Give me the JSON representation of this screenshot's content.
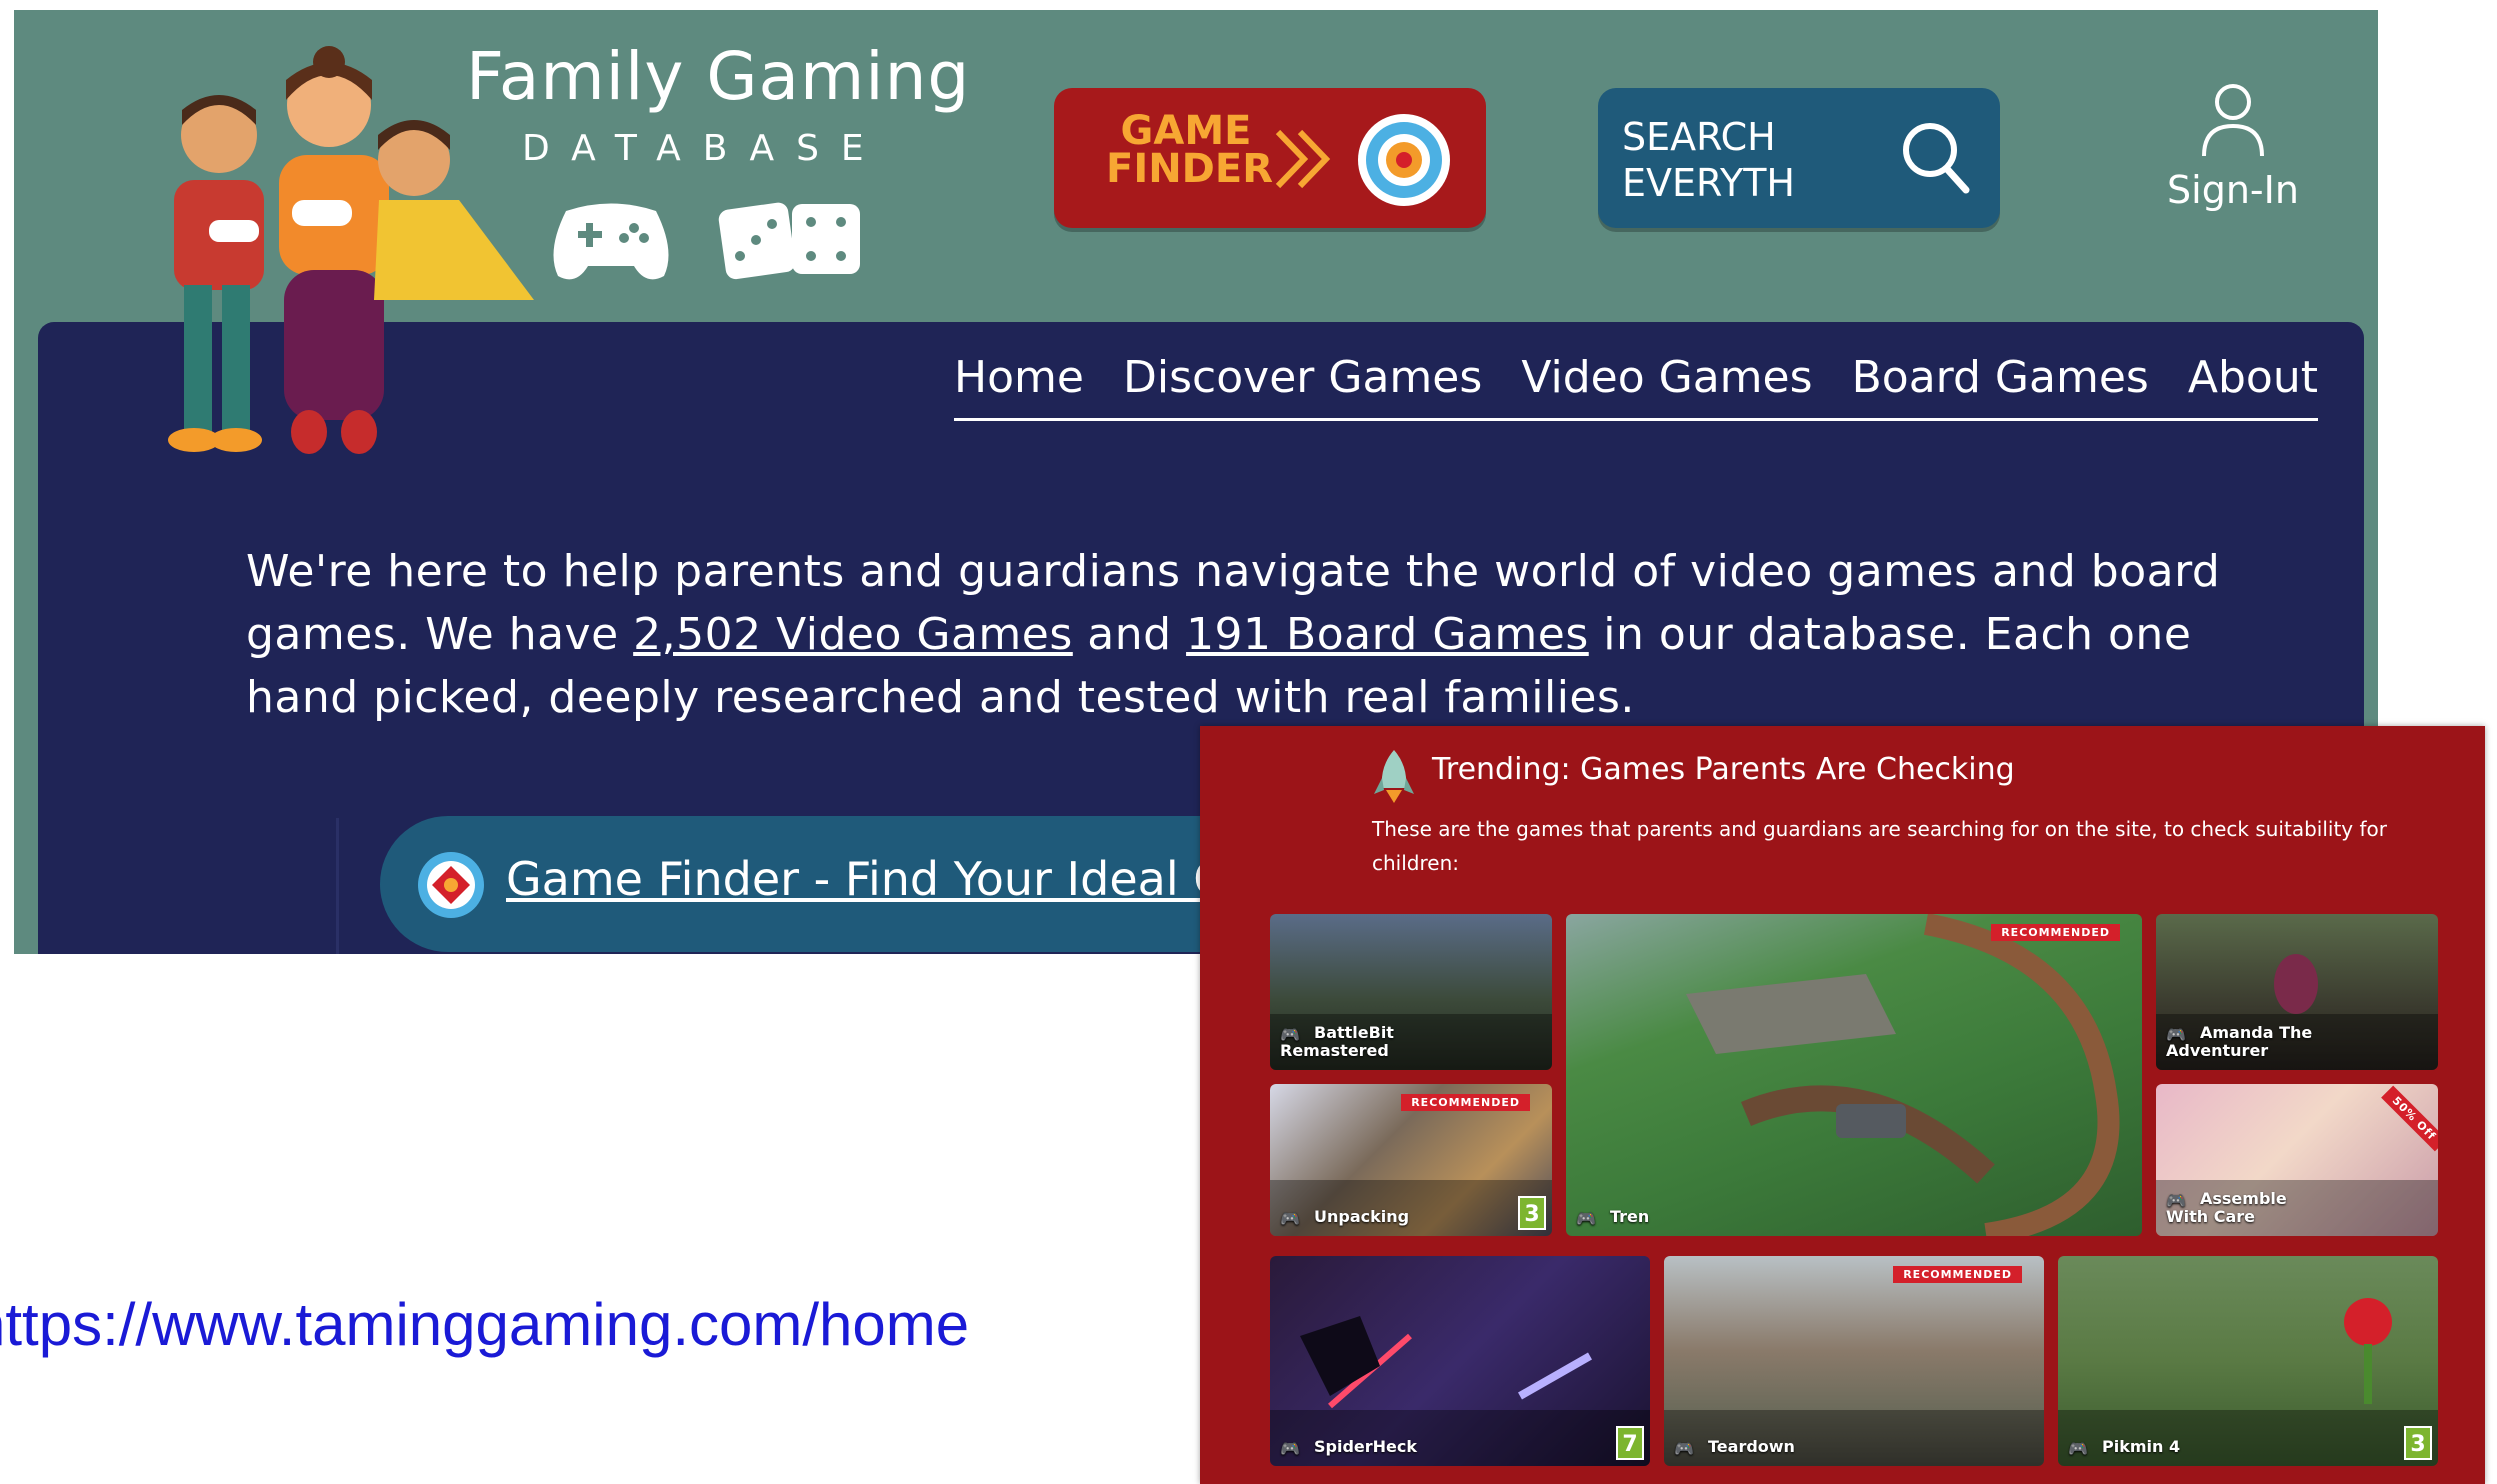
{
  "site": {
    "logo_title": "Family Gaming",
    "logo_subtitle": "DATABASE",
    "game_finder_label": "GAME\nFINDER",
    "search_label": "SEARCH\nEVERYTH",
    "signin_label": "Sign-In",
    "nav": [
      "Home",
      "Discover Games",
      "Video Games",
      "Board Games",
      "About"
    ],
    "intro": {
      "part1": "We're here to help parents and guardians navigate the world of video games and board games. We have ",
      "video_games_link": "2,502 Video Games",
      "part2": " and ",
      "board_games_link": "191 Board Games",
      "part3": " in our database. Each one hand picked, deeply researched and tested with real families."
    },
    "finder_link": "Game Finder - Find Your Ideal G"
  },
  "url": "https://www.taminggaming.com/home",
  "trending": {
    "title": "Trending: Games Parents Are Checking",
    "description": "These are the games that parents and guardians are searching for on the site, to check suitability for children:",
    "tiles": [
      {
        "name": "BattleBit Remastered",
        "badge": "",
        "rating": ""
      },
      {
        "name": "Tren",
        "badge": "RECOMMENDED",
        "rating": ""
      },
      {
        "name": "Amanda The Adventurer",
        "badge": "",
        "rating": ""
      },
      {
        "name": "Unpacking",
        "badge": "RECOMMENDED",
        "rating": "3"
      },
      {
        "name": "Assemble With Care",
        "badge": "50% Off",
        "rating": ""
      },
      {
        "name": "SpiderHeck",
        "badge": "",
        "rating": "7"
      },
      {
        "name": "Teardown",
        "badge": "RECOMMENDED",
        "rating": ""
      },
      {
        "name": "Pikmin 4",
        "badge": "",
        "rating": "3"
      }
    ]
  },
  "colors": {
    "header_green": "#5e8a7f",
    "nav_navy": "#1f2456",
    "game_finder_red": "#a7191b",
    "search_blue": "#1f5a7a",
    "trending_red": "#9c1418",
    "link_blue": "#1a1ad6"
  },
  "icons": [
    "controller-icon",
    "dice-icon",
    "target-icon",
    "search-icon",
    "user-icon",
    "rocket-icon",
    "gamepad-icon"
  ]
}
